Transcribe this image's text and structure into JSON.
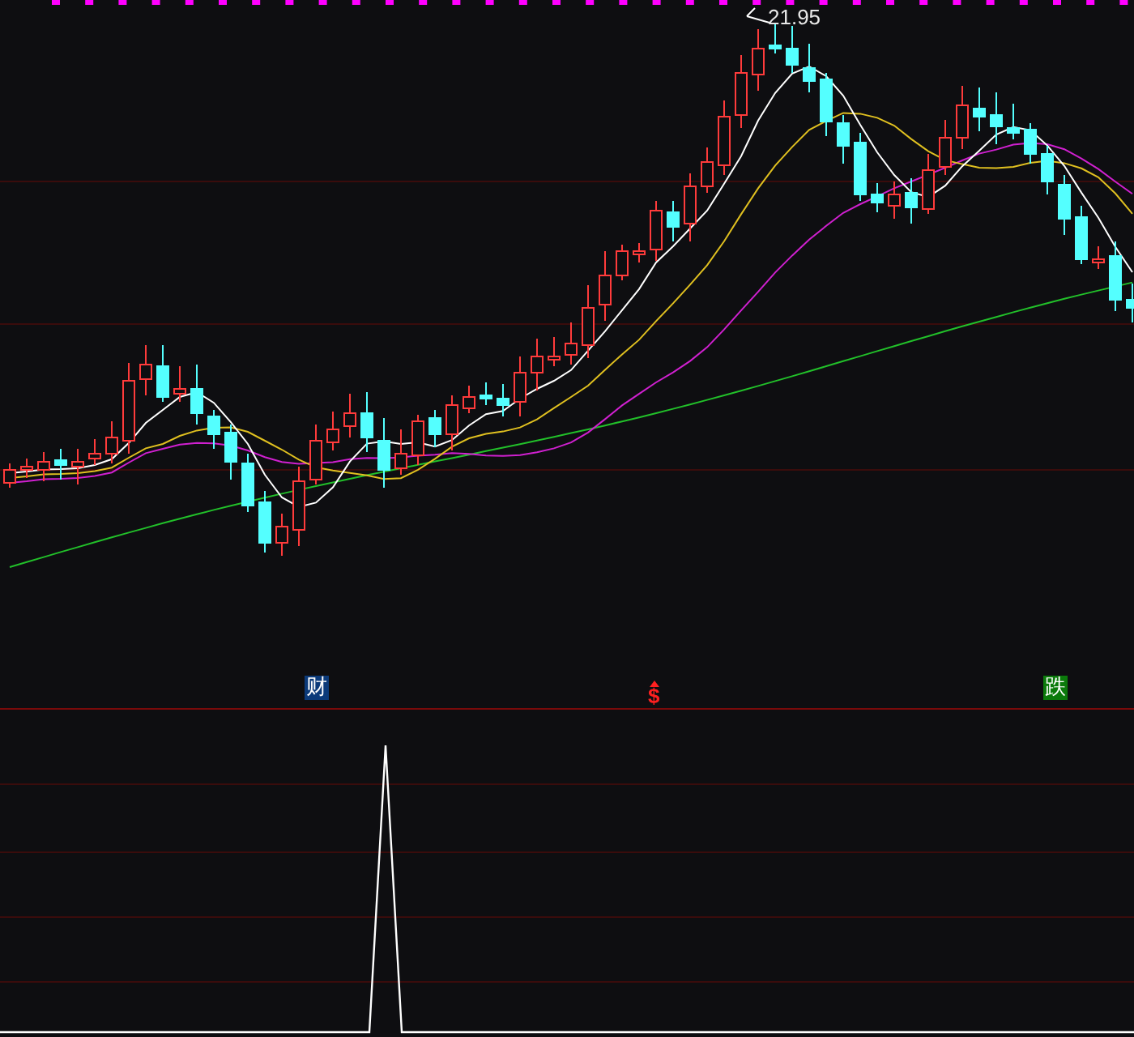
{
  "price_chart": {
    "high_label": "21.95"
  },
  "signals": [
    {
      "kind": "news",
      "text": "财"
    },
    {
      "kind": "dollar",
      "text": "$"
    },
    {
      "kind": "fall",
      "text": "跌"
    }
  ]
}
